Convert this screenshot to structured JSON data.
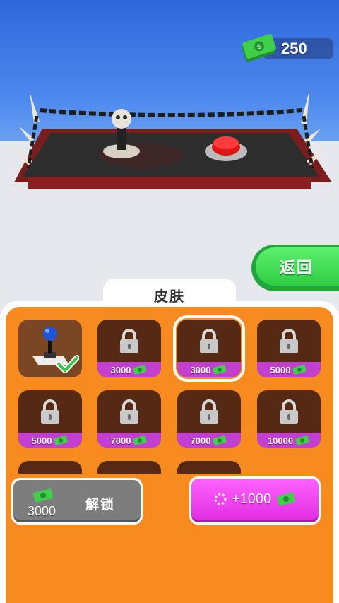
{
  "hud": {
    "money": "250",
    "money_icon": "cash-stack-icon"
  },
  "back_button": {
    "label": "返回"
  },
  "panel": {
    "tab_label": "皮肤"
  },
  "skins": [
    {
      "price": "",
      "owned": true,
      "icon": "joystick-icon"
    },
    {
      "price": "3000",
      "locked": true,
      "icon": "lock-icon"
    },
    {
      "price": "3000",
      "locked": true,
      "selected": true,
      "icon": "lock-icon"
    },
    {
      "price": "5000",
      "locked": true,
      "icon": "lock-icon"
    },
    {
      "price": "5000",
      "locked": true,
      "icon": "lock-icon"
    },
    {
      "price": "7000",
      "locked": true,
      "icon": "lock-icon"
    },
    {
      "price": "7000",
      "locked": true,
      "icon": "lock-icon"
    },
    {
      "price": "10000",
      "locked": true,
      "icon": "lock-icon"
    }
  ],
  "unlock_button": {
    "price": "3000",
    "label": "解锁"
  },
  "bonus_button": {
    "label": "+1000",
    "icon": "video-loading-icon"
  },
  "colors": {
    "sky": "#3b78e6",
    "panel_orange": "#f78b20",
    "price_purple": "#c33fd0",
    "green_button": "#2fcc43"
  }
}
